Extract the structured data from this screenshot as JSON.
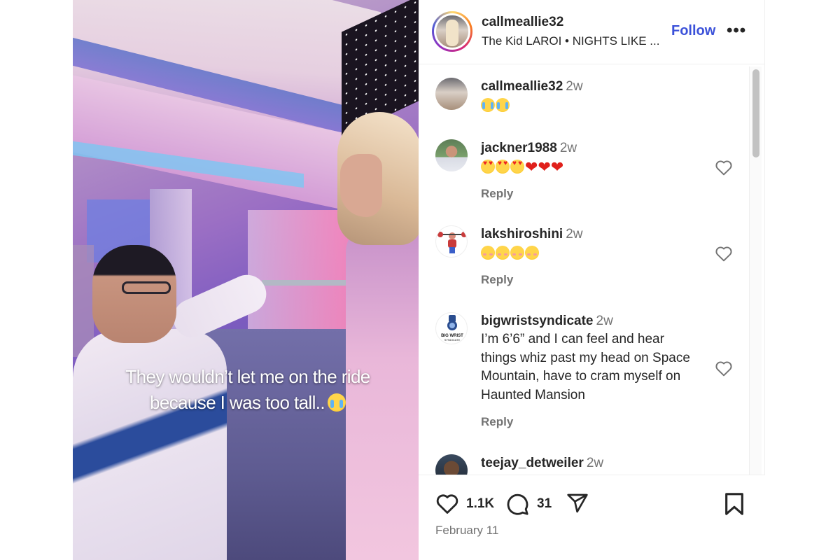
{
  "media": {
    "caption_line1": "They wouldn’t let me on the ride",
    "caption_line2": "because I was too tall..",
    "caption_emoji": "loudly-crying-face"
  },
  "header": {
    "username": "callmeallie32",
    "music": "The Kid LAROI • NIGHTS LIKE ...",
    "follow_label": "Follow",
    "more_label": "•••"
  },
  "comments": [
    {
      "username": "callmeallie32",
      "time": "2w",
      "text": "😭😭",
      "emojis": [
        "loudly-crying-face",
        "loudly-crying-face"
      ]
    },
    {
      "username": "jackner1988",
      "time": "2w",
      "text": "😍😍😍❤️❤️❤️",
      "reply_label": "Reply"
    },
    {
      "username": "lakshiroshini",
      "time": "2w",
      "text": "😊😊😊😊",
      "reply_label": "Reply"
    },
    {
      "username": "bigwristsyndicate",
      "time": "2w",
      "text": "I’m 6’6” and I can feel and hear things whiz past my head on Space Mountain, have to cram myself on Haunted Mansion",
      "avatar_text": "BIG WRIST SYNDICATE",
      "reply_label": "Reply"
    },
    {
      "username": "teejay_detweiler",
      "time": "2w"
    }
  ],
  "actions": {
    "likes": "1.1K",
    "comments": "31",
    "date": "February 11"
  },
  "colors": {
    "follow": "#3b51d9",
    "text": "#262626",
    "muted": "#737373",
    "heart_red": "#e0201b"
  }
}
